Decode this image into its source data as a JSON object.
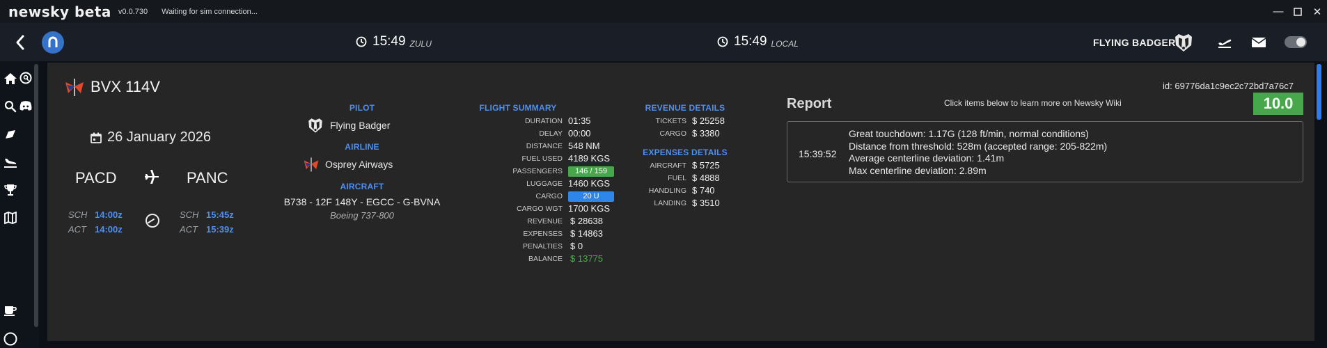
{
  "titlebar": {
    "app_name": "newsky beta",
    "version": "v0.0.730",
    "status": "Waiting for sim connection..."
  },
  "topnav": {
    "zulu_time": "15:49",
    "zulu_label": "ZULU",
    "local_time": "15:49",
    "local_label": "LOCAL",
    "username": "FLYING BADGER",
    "toggle_on": true
  },
  "sidebar": {
    "items": [
      "home-icon",
      "search-icon",
      "tag-icon",
      "landing-icon",
      "trophy-icon",
      "map-icon",
      "coffee-icon",
      "help-icon"
    ],
    "secondary": [
      "map-search-icon",
      "discord-icon"
    ]
  },
  "flight": {
    "callsign": "BVX 114V",
    "id": "id: 69776da1c9ec2c72bd7a76c7",
    "date": "26 January 2026",
    "departure": "PACD",
    "arrival": "PANC",
    "sch_label": "SCH",
    "act_label": "ACT",
    "dep_sch": "14:00z",
    "dep_act": "14:00z",
    "arr_sch": "15:45z",
    "arr_act": "15:39z"
  },
  "pilot": {
    "heading": "PILOT",
    "name": "Flying Badger",
    "airline_heading": "AIRLINE",
    "airline": "Osprey Airways",
    "aircraft_heading": "AIRCRAFT",
    "aircraft": "B738 - 12F 148Y - EGCC - G-BVNA",
    "aircraft_type": "Boeing 737-800"
  },
  "summary": {
    "heading": "FLIGHT SUMMARY",
    "rows": [
      {
        "k": "DURATION",
        "v": "01:35"
      },
      {
        "k": "DELAY",
        "v": "00:00"
      },
      {
        "k": "DISTANCE",
        "v": "548 NM"
      },
      {
        "k": "FUEL USED",
        "v": "4189 KGS"
      },
      {
        "k": "PASSENGERS",
        "v": "146 / 159"
      },
      {
        "k": "LUGGAGE",
        "v": "1460 KGS"
      },
      {
        "k": "CARGO",
        "v": "20 U"
      },
      {
        "k": "CARGO WGT",
        "v": "1700 KGS"
      },
      {
        "k": "REVENUE",
        "v": "$ 28638"
      },
      {
        "k": "EXPENSES",
        "v": "$ 14863"
      },
      {
        "k": "PENALTIES",
        "v": "$ 0"
      },
      {
        "k": "BALANCE",
        "v": "$ 13775"
      }
    ],
    "passengers_color": "#46a84a",
    "cargo_color": "#2e86e8",
    "balance_color": "#4caf50"
  },
  "revenue": {
    "heading": "REVENUE DETAILS",
    "rows": [
      {
        "k": "TICKETS",
        "v": "$ 25258"
      },
      {
        "k": "CARGO",
        "v": "$ 3380"
      }
    ]
  },
  "expenses": {
    "heading": "EXPENSES DETAILS",
    "rows": [
      {
        "k": "AIRCRAFT",
        "v": "$ 5725"
      },
      {
        "k": "FUEL",
        "v": "$ 4888"
      },
      {
        "k": "HANDLING",
        "v": "$ 740"
      },
      {
        "k": "LANDING",
        "v": "$ 3510"
      }
    ]
  },
  "report": {
    "title": "Report",
    "hint": "Click items below to learn more on Newsky Wiki",
    "score": "10.0",
    "score_color": "#46a84a",
    "entry_time": "15:39:52",
    "lines": [
      "Great touchdown: 1.17G (128 ft/min, normal conditions)",
      "Distance from threshold: 528m (accepted range: 205-822m)",
      "Average centerline deviation: 1.41m",
      "Max centerline deviation: 2.89m"
    ]
  }
}
